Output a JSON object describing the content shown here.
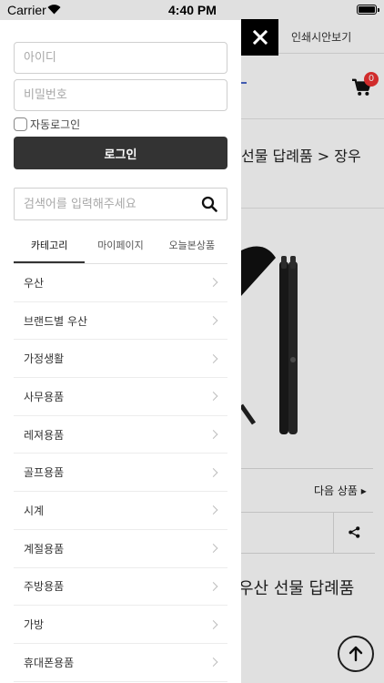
{
  "status_bar": {
    "carrier": "Carrier",
    "time": "4:40 PM"
  },
  "background_page": {
    "print_quote_link": "인쇄시안보기",
    "cart_count": "0",
    "breadcrumb": "선물 답례품 > 장우",
    "next_product": "다음 상품",
    "product_title": "우산 선물 답례품"
  },
  "drawer": {
    "id_placeholder": "아이디",
    "password_placeholder": "비밀번호",
    "auto_login_label": "자동로그인",
    "login_button": "로그인",
    "search_placeholder": "검색어를 입력해주세요",
    "tabs": [
      {
        "label": "카테고리",
        "active": true
      },
      {
        "label": "마이페이지",
        "active": false
      },
      {
        "label": "오늘본상품",
        "active": false
      }
    ],
    "categories": [
      "우산",
      "브랜드별 우산",
      "가정생활",
      "사무용품",
      "레져용품",
      "골프용품",
      "시계",
      "계절용품",
      "주방용품",
      "가방",
      "휴대폰용품"
    ]
  },
  "colors": {
    "login_button_bg": "#333333",
    "cart_badge": "#e33333",
    "close_button_bg": "#000000"
  }
}
